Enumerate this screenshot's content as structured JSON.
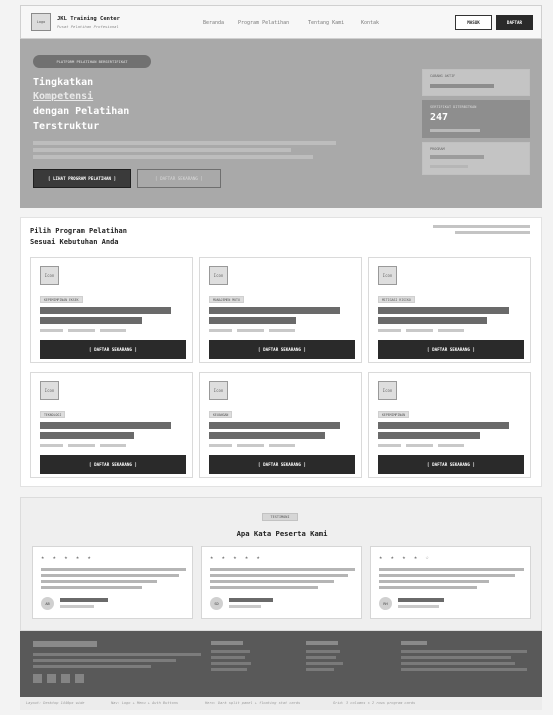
{
  "header": {
    "logo_label": "Logo",
    "brand": "JKL Training Center",
    "tagline": "Pusat Pelatihan Profesional",
    "nav": [
      "Beranda",
      "Program Pelatihan",
      "Tentang Kami",
      "Kontak"
    ],
    "login_label": "MASUK",
    "register_label": "DAFTAR"
  },
  "hero": {
    "badge": "PLATFORM PELATIHAN BERSERTIFIKAT",
    "headline_line1": "Tingkatkan",
    "headline_highlight": "Kompetensi",
    "headline_line3": "dengan Pelatihan",
    "headline_line4": "Terstruktur",
    "primary_cta": "[ LIHAT PROGRAM PELATIHAN ]",
    "secondary_cta": "[ DAFTAR SEKARANG ]",
    "stats": [
      {
        "label": "CABANG AKTIF",
        "value": ""
      },
      {
        "label": "SERTIFIKAT DITERBITKAN",
        "value": "247"
      },
      {
        "label": "PROGRAM",
        "value": ""
      }
    ]
  },
  "programs": {
    "heading_line1": "Pilih Program Pelatihan",
    "heading_line2": "Sesuai Kebutuhan Anda",
    "icon_label": "Icon",
    "cards": [
      {
        "tag": "KEPEMIMPINAN EKSEK",
        "cta": "[ DAFTAR SEKARANG ]"
      },
      {
        "tag": "MANAJEMEN MUTU",
        "cta": "[ DAFTAR SEKARANG ]"
      },
      {
        "tag": "MITIGASI RISIKO",
        "cta": "[ DAFTAR SEKARANG ]"
      },
      {
        "tag": "TEKNOLOGI",
        "cta": "[ DAFTAR SEKARANG ]"
      },
      {
        "tag": "KEUANGAN",
        "cta": "[ DAFTAR SEKARANG ]"
      },
      {
        "tag": "KEPEMIMPINAN",
        "cta": "[ DAFTAR SEKARANG ]"
      }
    ]
  },
  "testimonials": {
    "badge": "TESTIMONI",
    "heading": "Apa Kata Peserta Kami",
    "items": [
      {
        "stars": "★ ★ ★ ★ ★",
        "initials": "AB"
      },
      {
        "stars": "★ ★ ★ ★ ★",
        "initials": "SD"
      },
      {
        "stars": "★ ★ ★ ★ ☆",
        "initials": "RH"
      }
    ]
  },
  "annotations": [
    "Layout: Desktop 1440px wide",
    "Nav: Logo + Menu + Auth Buttons",
    "Hero: Dark split panel + floating stat cards",
    "Grid: 3 columns × 2 rows program cards"
  ]
}
